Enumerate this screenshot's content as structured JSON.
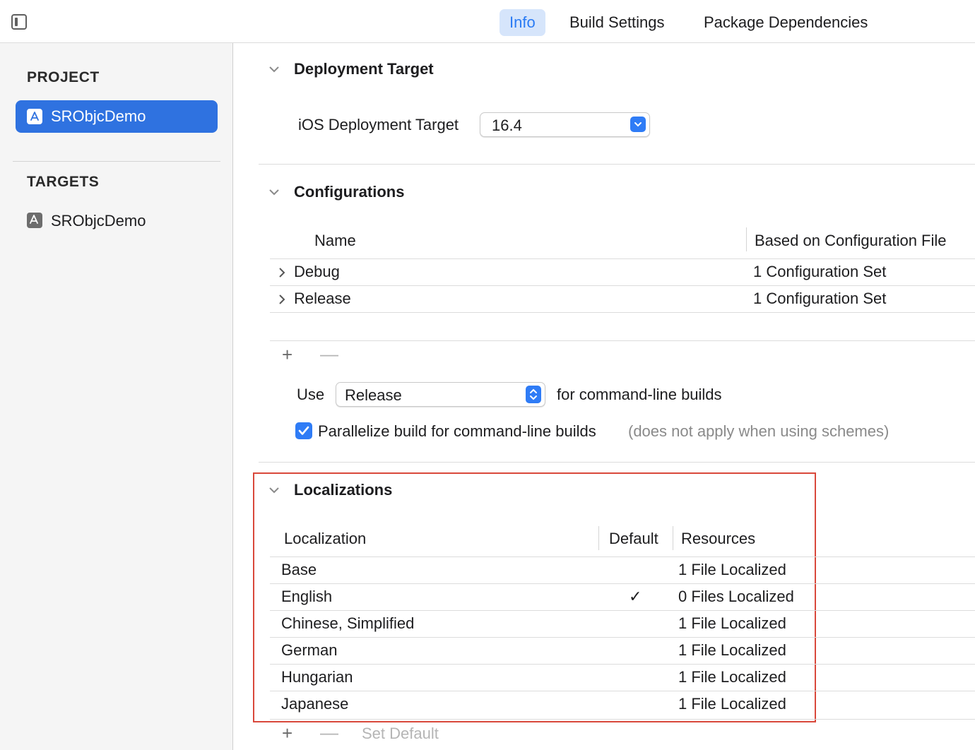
{
  "tabs": [
    {
      "label": "Info"
    },
    {
      "label": "Build Settings"
    },
    {
      "label": "Package Dependencies"
    }
  ],
  "sidebar": {
    "project_header": "PROJECT",
    "project_item": "SRObjcDemo",
    "targets_header": "TARGETS",
    "target_item": "SRObjcDemo"
  },
  "deployment": {
    "title": "Deployment Target",
    "label": "iOS Deployment Target",
    "value": "16.4"
  },
  "configurations": {
    "title": "Configurations",
    "columns": [
      "Name",
      "Based on Configuration File"
    ],
    "rows": [
      {
        "name": "Debug",
        "file": "1 Configuration Set"
      },
      {
        "name": "Release",
        "file": "1 Configuration Set"
      }
    ],
    "use_label": "Use",
    "use_value": "Release",
    "use_suffix": "for command-line builds",
    "parallelize_label": "Parallelize build for command-line builds",
    "parallelize_note": "(does not apply when using schemes)",
    "parallelize_checked": true
  },
  "localizations": {
    "title": "Localizations",
    "columns": [
      "Localization",
      "Default",
      "Resources"
    ],
    "rows": [
      {
        "name": "Base",
        "default": "",
        "resources": "1 File Localized"
      },
      {
        "name": "English",
        "default": "✓",
        "resources": "0 Files Localized"
      },
      {
        "name": "Chinese, Simplified",
        "default": "",
        "resources": "1 File Localized"
      },
      {
        "name": "German",
        "default": "",
        "resources": "1 File Localized"
      },
      {
        "name": "Hungarian",
        "default": "",
        "resources": "1 File Localized"
      },
      {
        "name": "Japanese",
        "default": "",
        "resources": "1 File Localized"
      }
    ],
    "set_default_label": "Set Default"
  },
  "add_symbol": "+",
  "remove_symbol": "—",
  "colors": {
    "accent": "#2f7cf6",
    "selection": "#2f72e0",
    "highlight_box": "#d9483b"
  }
}
